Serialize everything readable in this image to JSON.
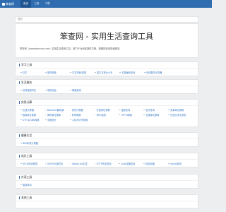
{
  "nav": {
    "logo": "笨查网",
    "items": [
      "首页",
      "工具",
      "下载"
    ]
  },
  "breadcrumb": "首页",
  "hero": {
    "title": "笨查网 - 实用生活查询工具",
    "desc": "笨查网（www.bencha.com）实用生活查询工具，致力于为网民提供方便、快捷的在线查询服务。"
  },
  "sections": [
    {
      "title": "学习工具",
      "rows": [
        [
          "汉字",
          "繁简转换",
          "汉字拼音/简繁",
          "英文字母大小写",
          "五笔编码查询",
          "在线数学计算器"
        ]
      ]
    },
    {
      "title": "生活服务",
      "rows": [
        [
          "世界各国时区",
          "常用电话",
          "邮编查询"
        ]
      ]
    },
    {
      "title": "实用计算",
      "rows": [
        [
          "在线计算器",
          "BaseA4 编码/解",
          "房贷计算器",
          "在线单位换算",
          "星座查询",
          "农历查询",
          "重量单位换算"
        ],
        [
          "数量单位换算",
          "体积单位换算",
          "时间换算",
          "MD5加密",
          "UTF-8转换",
          "长度单位换算",
          "在线文本去重复"
        ],
        [
          "UTF-8/GBK转换",
          "字数统计",
          "人民币大写转换"
        ]
      ]
    },
    {
      "title": "健康生活",
      "rows": [
        [
          "BMI体重计算器"
        ]
      ]
    },
    {
      "title": "站长工具",
      "rows": [
        [
          "ASCII码对照表",
          "JS/HTML格式化",
          "robots.txt生成",
          "HTTP状态查询",
          "Gzip压缩检测",
          "网站测速",
          "whois查询"
        ]
      ]
    },
    {
      "title": "外语工具",
      "rows": [
        [
          "英语单词"
        ]
      ]
    },
    {
      "title": "其他工具",
      "rows": []
    }
  ]
}
